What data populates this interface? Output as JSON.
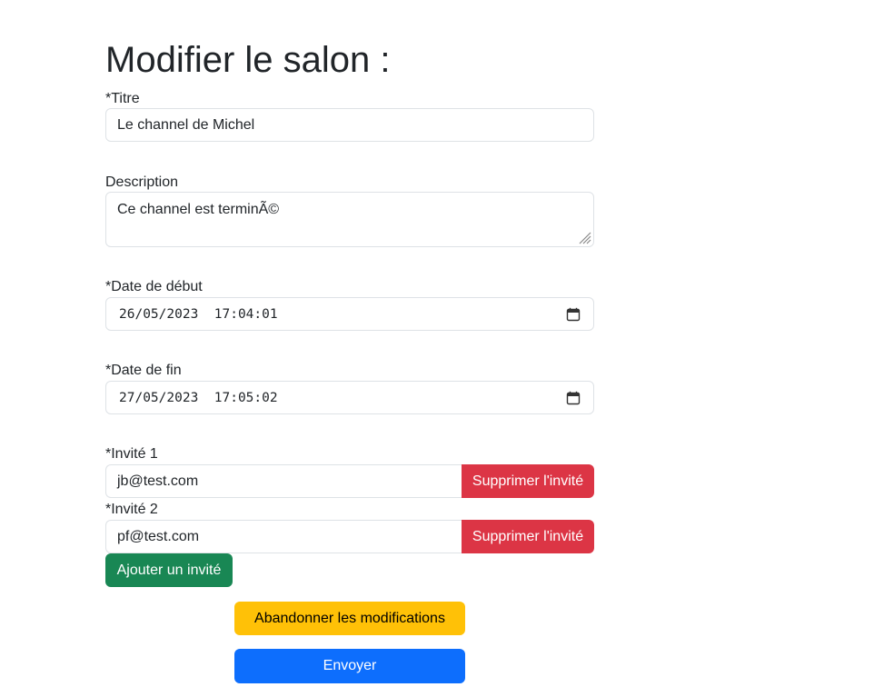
{
  "page": {
    "title": "Modifier le salon :"
  },
  "form": {
    "title_label": "*Titre",
    "title_value": "Le channel de Michel",
    "description_label": "Description",
    "description_value": "Ce channel est terminÃ©",
    "start_label": "*Date de début",
    "start_value": "26/05/2023  17:04:01",
    "end_label": "*Date de fin",
    "end_value": "27/05/2023  17:05:02",
    "guests": [
      {
        "label": "*Invité 1",
        "email": "jb@test.com",
        "remove_label": "Supprimer l'invité"
      },
      {
        "label": "*Invité 2",
        "email": "pf@test.com",
        "remove_label": "Supprimer l'invité"
      }
    ],
    "add_guest_label": "Ajouter un invité",
    "cancel_label": "Abandonner les modifications",
    "submit_label": "Envoyer"
  },
  "icons": {
    "date_picker": "calendar-icon",
    "textarea_resize": "resize-grip-icon"
  },
  "colors": {
    "danger": "#dc3545",
    "success": "#198754",
    "warning": "#ffc107",
    "primary": "#0d6efd",
    "border": "#dee2e6"
  }
}
